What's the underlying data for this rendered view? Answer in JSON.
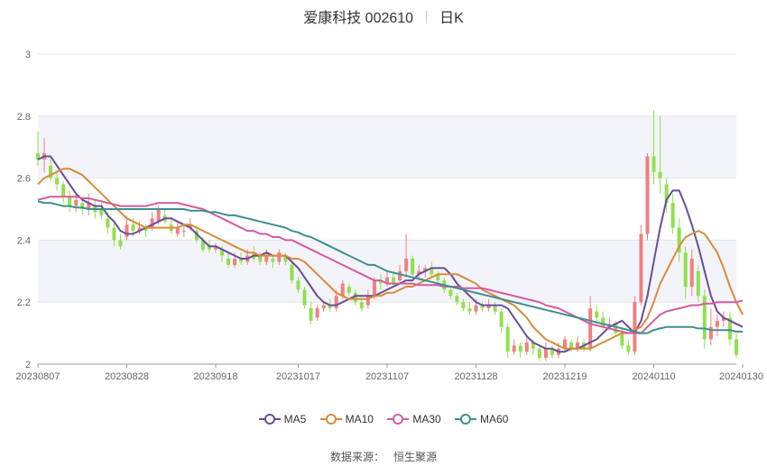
{
  "header": {
    "stock_name": "爱康科技 002610",
    "period": "日K"
  },
  "legend": [
    {
      "name": "MA5",
      "color": "#6a4c9c"
    },
    {
      "name": "MA10",
      "color": "#d98b3a"
    },
    {
      "name": "MA30",
      "color": "#d65aa0"
    },
    {
      "name": "MA60",
      "color": "#3f8f8f"
    }
  ],
  "source": {
    "label": "数据来源：",
    "value": "恒生聚源"
  },
  "colors": {
    "up": "#f08080",
    "down": "#90e050",
    "band": "#f3f4f9",
    "grid": "#e6e6e6"
  },
  "chart_data": {
    "type": "candlestick",
    "ylim": [
      2,
      3
    ],
    "y_ticks": [
      "2",
      "2.2",
      "2.4",
      "2.6",
      "2.8",
      "3"
    ],
    "x_tick_labels": [
      "20230807",
      "20230828",
      "20230918",
      "20231017",
      "20231107",
      "20231128",
      "20231219",
      "20240110",
      "20240130"
    ],
    "series": [
      {
        "name": "MA5",
        "values": [
          2.66,
          2.67,
          2.67,
          2.64,
          2.61,
          2.58,
          2.55,
          2.53,
          2.52,
          2.51,
          2.51,
          2.48,
          2.46,
          2.43,
          2.42,
          2.42,
          2.43,
          2.44,
          2.45,
          2.46,
          2.47,
          2.47,
          2.46,
          2.45,
          2.44,
          2.42,
          2.4,
          2.38,
          2.38,
          2.37,
          2.36,
          2.35,
          2.34,
          2.34,
          2.35,
          2.35,
          2.36,
          2.35,
          2.35,
          2.35,
          2.33,
          2.31,
          2.28,
          2.25,
          2.22,
          2.2,
          2.19,
          2.19,
          2.2,
          2.21,
          2.22,
          2.22,
          2.22,
          2.22,
          2.23,
          2.24,
          2.25,
          2.26,
          2.27,
          2.27,
          2.29,
          2.3,
          2.31,
          2.31,
          2.31,
          2.29,
          2.26,
          2.24,
          2.22,
          2.2,
          2.19,
          2.19,
          2.19,
          2.19,
          2.18,
          2.15,
          2.12,
          2.09,
          2.07,
          2.06,
          2.05,
          2.05,
          2.04,
          2.04,
          2.05,
          2.05,
          2.06,
          2.07,
          2.08,
          2.1,
          2.12,
          2.13,
          2.14,
          2.12,
          2.1,
          2.14,
          2.22,
          2.33,
          2.44,
          2.53,
          2.56,
          2.56,
          2.51,
          2.45,
          2.38,
          2.3,
          2.22,
          2.17,
          2.15,
          2.14,
          2.13,
          2.12
        ]
      },
      {
        "name": "MA10",
        "values": [
          2.58,
          2.6,
          2.61,
          2.62,
          2.63,
          2.63,
          2.62,
          2.61,
          2.59,
          2.57,
          2.55,
          2.53,
          2.51,
          2.49,
          2.47,
          2.46,
          2.45,
          2.44,
          2.44,
          2.44,
          2.44,
          2.44,
          2.44,
          2.45,
          2.45,
          2.44,
          2.43,
          2.42,
          2.41,
          2.4,
          2.39,
          2.38,
          2.37,
          2.36,
          2.36,
          2.35,
          2.35,
          2.35,
          2.35,
          2.35,
          2.34,
          2.34,
          2.33,
          2.31,
          2.29,
          2.27,
          2.25,
          2.23,
          2.22,
          2.21,
          2.21,
          2.21,
          2.21,
          2.22,
          2.22,
          2.23,
          2.23,
          2.24,
          2.25,
          2.25,
          2.26,
          2.27,
          2.28,
          2.29,
          2.29,
          2.29,
          2.29,
          2.28,
          2.27,
          2.26,
          2.24,
          2.23,
          2.22,
          2.21,
          2.2,
          2.19,
          2.17,
          2.15,
          2.12,
          2.1,
          2.08,
          2.07,
          2.06,
          2.05,
          2.05,
          2.05,
          2.05,
          2.05,
          2.06,
          2.07,
          2.08,
          2.09,
          2.1,
          2.1,
          2.11,
          2.12,
          2.15,
          2.2,
          2.26,
          2.3,
          2.34,
          2.38,
          2.41,
          2.42,
          2.43,
          2.42,
          2.39,
          2.36,
          2.31,
          2.25,
          2.2,
          2.16
        ]
      },
      {
        "name": "MA30",
        "values": [
          2.53,
          2.535,
          2.54,
          2.54,
          2.54,
          2.54,
          2.54,
          2.535,
          2.535,
          2.53,
          2.525,
          2.52,
          2.515,
          2.51,
          2.51,
          2.51,
          2.51,
          2.51,
          2.515,
          2.52,
          2.52,
          2.52,
          2.52,
          2.515,
          2.51,
          2.505,
          2.5,
          2.49,
          2.48,
          2.47,
          2.46,
          2.45,
          2.44,
          2.43,
          2.43,
          2.42,
          2.42,
          2.41,
          2.41,
          2.4,
          2.4,
          2.39,
          2.38,
          2.37,
          2.36,
          2.35,
          2.34,
          2.33,
          2.32,
          2.31,
          2.3,
          2.29,
          2.28,
          2.27,
          2.27,
          2.26,
          2.26,
          2.26,
          2.26,
          2.26,
          2.255,
          2.255,
          2.255,
          2.255,
          2.25,
          2.25,
          2.25,
          2.245,
          2.245,
          2.245,
          2.245,
          2.24,
          2.235,
          2.23,
          2.225,
          2.22,
          2.215,
          2.21,
          2.205,
          2.2,
          2.19,
          2.185,
          2.18,
          2.17,
          2.16,
          2.15,
          2.14,
          2.13,
          2.125,
          2.12,
          2.115,
          2.11,
          2.105,
          2.1,
          2.1,
          2.1,
          2.12,
          2.14,
          2.16,
          2.17,
          2.175,
          2.18,
          2.185,
          2.19,
          2.19,
          2.195,
          2.195,
          2.2,
          2.2,
          2.2,
          2.2,
          2.205
        ]
      },
      {
        "name": "MA60",
        "values": [
          2.525,
          2.52,
          2.52,
          2.515,
          2.51,
          2.51,
          2.505,
          2.505,
          2.5,
          2.5,
          2.5,
          2.5,
          2.5,
          2.5,
          2.5,
          2.5,
          2.5,
          2.5,
          2.5,
          2.5,
          2.5,
          2.5,
          2.5,
          2.5,
          2.495,
          2.495,
          2.495,
          2.49,
          2.49,
          2.485,
          2.48,
          2.48,
          2.475,
          2.47,
          2.465,
          2.46,
          2.455,
          2.45,
          2.445,
          2.44,
          2.43,
          2.425,
          2.415,
          2.41,
          2.4,
          2.39,
          2.38,
          2.37,
          2.36,
          2.35,
          2.34,
          2.33,
          2.32,
          2.32,
          2.31,
          2.3,
          2.295,
          2.29,
          2.285,
          2.28,
          2.275,
          2.27,
          2.265,
          2.26,
          2.255,
          2.25,
          2.245,
          2.24,
          2.235,
          2.23,
          2.225,
          2.22,
          2.215,
          2.21,
          2.205,
          2.2,
          2.195,
          2.19,
          2.185,
          2.18,
          2.175,
          2.17,
          2.165,
          2.16,
          2.155,
          2.15,
          2.145,
          2.14,
          2.135,
          2.13,
          2.125,
          2.12,
          2.115,
          2.11,
          2.105,
          2.1,
          2.1,
          2.11,
          2.115,
          2.12,
          2.12,
          2.12,
          2.12,
          2.12,
          2.115,
          2.115,
          2.11,
          2.11,
          2.11,
          2.11,
          2.105,
          2.105
        ]
      }
    ],
    "candles": [
      [
        2.68,
        2.66,
        2.75,
        2.64
      ],
      [
        2.66,
        2.68,
        2.73,
        2.62
      ],
      [
        2.64,
        2.6,
        2.66,
        2.59
      ],
      [
        2.6,
        2.58,
        2.62,
        2.56
      ],
      [
        2.58,
        2.54,
        2.59,
        2.52
      ],
      [
        2.54,
        2.51,
        2.56,
        2.49
      ],
      [
        2.51,
        2.53,
        2.55,
        2.49
      ],
      [
        2.52,
        2.5,
        2.54,
        2.48
      ],
      [
        2.5,
        2.52,
        2.55,
        2.48
      ],
      [
        2.51,
        2.49,
        2.53,
        2.47
      ],
      [
        2.5,
        2.48,
        2.52,
        2.47
      ],
      [
        2.47,
        2.44,
        2.49,
        2.42
      ],
      [
        2.44,
        2.4,
        2.46,
        2.38
      ],
      [
        2.4,
        2.38,
        2.42,
        2.37
      ],
      [
        2.41,
        2.45,
        2.48,
        2.4
      ],
      [
        2.45,
        2.43,
        2.47,
        2.41
      ],
      [
        2.43,
        2.44,
        2.46,
        2.42
      ],
      [
        2.44,
        2.43,
        2.45,
        2.41
      ],
      [
        2.44,
        2.47,
        2.49,
        2.43
      ],
      [
        2.46,
        2.5,
        2.51,
        2.45
      ],
      [
        2.48,
        2.46,
        2.5,
        2.45
      ],
      [
        2.45,
        2.43,
        2.47,
        2.42
      ],
      [
        2.42,
        2.44,
        2.46,
        2.41
      ],
      [
        2.43,
        2.43,
        2.45,
        2.41
      ],
      [
        2.44,
        2.45,
        2.47,
        2.43
      ],
      [
        2.43,
        2.4,
        2.45,
        2.39
      ],
      [
        2.4,
        2.37,
        2.41,
        2.36
      ],
      [
        2.38,
        2.37,
        2.4,
        2.36
      ],
      [
        2.37,
        2.38,
        2.39,
        2.36
      ],
      [
        2.37,
        2.35,
        2.38,
        2.33
      ],
      [
        2.34,
        2.32,
        2.36,
        2.31
      ],
      [
        2.32,
        2.34,
        2.36,
        2.31
      ],
      [
        2.34,
        2.33,
        2.36,
        2.32
      ],
      [
        2.33,
        2.35,
        2.37,
        2.32
      ],
      [
        2.36,
        2.34,
        2.38,
        2.33
      ],
      [
        2.35,
        2.33,
        2.36,
        2.32
      ],
      [
        2.33,
        2.35,
        2.37,
        2.32
      ],
      [
        2.34,
        2.33,
        2.35,
        2.31
      ],
      [
        2.33,
        2.36,
        2.37,
        2.32
      ],
      [
        2.35,
        2.33,
        2.36,
        2.32
      ],
      [
        2.32,
        2.27,
        2.33,
        2.26
      ],
      [
        2.27,
        2.24,
        2.28,
        2.23
      ],
      [
        2.24,
        2.19,
        2.25,
        2.18
      ],
      [
        2.18,
        2.14,
        2.2,
        2.13
      ],
      [
        2.15,
        2.18,
        2.19,
        2.14
      ],
      [
        2.18,
        2.19,
        2.2,
        2.17
      ],
      [
        2.19,
        2.18,
        2.21,
        2.17
      ],
      [
        2.18,
        2.22,
        2.24,
        2.17
      ],
      [
        2.22,
        2.26,
        2.27,
        2.21
      ],
      [
        2.25,
        2.23,
        2.26,
        2.22
      ],
      [
        2.23,
        2.2,
        2.24,
        2.19
      ],
      [
        2.2,
        2.18,
        2.21,
        2.17
      ],
      [
        2.19,
        2.22,
        2.24,
        2.18
      ],
      [
        2.22,
        2.27,
        2.28,
        2.21
      ],
      [
        2.27,
        2.26,
        2.29,
        2.24
      ],
      [
        2.26,
        2.28,
        2.3,
        2.25
      ],
      [
        2.28,
        2.26,
        2.3,
        2.25
      ],
      [
        2.27,
        2.3,
        2.32,
        2.26
      ],
      [
        2.3,
        2.34,
        2.42,
        2.28
      ],
      [
        2.34,
        2.29,
        2.35,
        2.28
      ],
      [
        2.29,
        2.3,
        2.32,
        2.27
      ],
      [
        2.3,
        2.31,
        2.32,
        2.28
      ],
      [
        2.31,
        2.29,
        2.33,
        2.28
      ],
      [
        2.29,
        2.27,
        2.3,
        2.25
      ],
      [
        2.27,
        2.24,
        2.28,
        2.23
      ],
      [
        2.24,
        2.22,
        2.25,
        2.21
      ],
      [
        2.22,
        2.2,
        2.23,
        2.19
      ],
      [
        2.2,
        2.18,
        2.21,
        2.17
      ],
      [
        2.18,
        2.17,
        2.2,
        2.16
      ],
      [
        2.17,
        2.19,
        2.21,
        2.16
      ],
      [
        2.19,
        2.18,
        2.2,
        2.17
      ],
      [
        2.18,
        2.19,
        2.21,
        2.17
      ],
      [
        2.19,
        2.17,
        2.2,
        2.16
      ],
      [
        2.17,
        2.12,
        2.18,
        2.1
      ],
      [
        2.12,
        2.04,
        2.13,
        2.02
      ],
      [
        2.04,
        2.06,
        2.08,
        2.03
      ],
      [
        2.06,
        2.04,
        2.07,
        2.02
      ],
      [
        2.04,
        2.07,
        2.09,
        2.03
      ],
      [
        2.07,
        2.05,
        2.08,
        2.03
      ],
      [
        2.05,
        2.02,
        2.06,
        2.01
      ],
      [
        2.02,
        2.05,
        2.07,
        2.01
      ],
      [
        2.05,
        2.03,
        2.06,
        2.02
      ],
      [
        2.03,
        2.05,
        2.07,
        2.02
      ],
      [
        2.05,
        2.08,
        2.09,
        2.04
      ],
      [
        2.07,
        2.05,
        2.08,
        2.04
      ],
      [
        2.05,
        2.07,
        2.09,
        2.04
      ],
      [
        2.07,
        2.05,
        2.08,
        2.04
      ],
      [
        2.05,
        2.18,
        2.22,
        2.04
      ],
      [
        2.17,
        2.15,
        2.19,
        2.13
      ],
      [
        2.15,
        2.12,
        2.17,
        2.11
      ],
      [
        2.12,
        2.13,
        2.15,
        2.11
      ],
      [
        2.13,
        2.1,
        2.14,
        2.09
      ],
      [
        2.1,
        2.06,
        2.12,
        2.05
      ],
      [
        2.06,
        2.04,
        2.08,
        2.03
      ],
      [
        2.04,
        2.2,
        2.22,
        2.03
      ],
      [
        2.2,
        2.42,
        2.45,
        2.19
      ],
      [
        2.42,
        2.67,
        2.68,
        2.4
      ],
      [
        2.67,
        2.62,
        2.82,
        2.58
      ],
      [
        2.62,
        2.6,
        2.8,
        2.55
      ],
      [
        2.58,
        2.52,
        2.6,
        2.49
      ],
      [
        2.52,
        2.44,
        2.55,
        2.42
      ],
      [
        2.44,
        2.36,
        2.47,
        2.33
      ],
      [
        2.36,
        2.25,
        2.38,
        2.21
      ],
      [
        2.25,
        2.34,
        2.37,
        2.22
      ],
      [
        2.3,
        2.22,
        2.32,
        2.2
      ],
      [
        2.22,
        2.08,
        2.24,
        2.05
      ],
      [
        2.08,
        2.12,
        2.18,
        2.06
      ],
      [
        2.12,
        2.14,
        2.16,
        2.09
      ],
      [
        2.14,
        2.15,
        2.17,
        2.12
      ],
      [
        2.15,
        2.08,
        2.17,
        2.06
      ],
      [
        2.08,
        2.03,
        2.1,
        2.02
      ]
    ]
  }
}
